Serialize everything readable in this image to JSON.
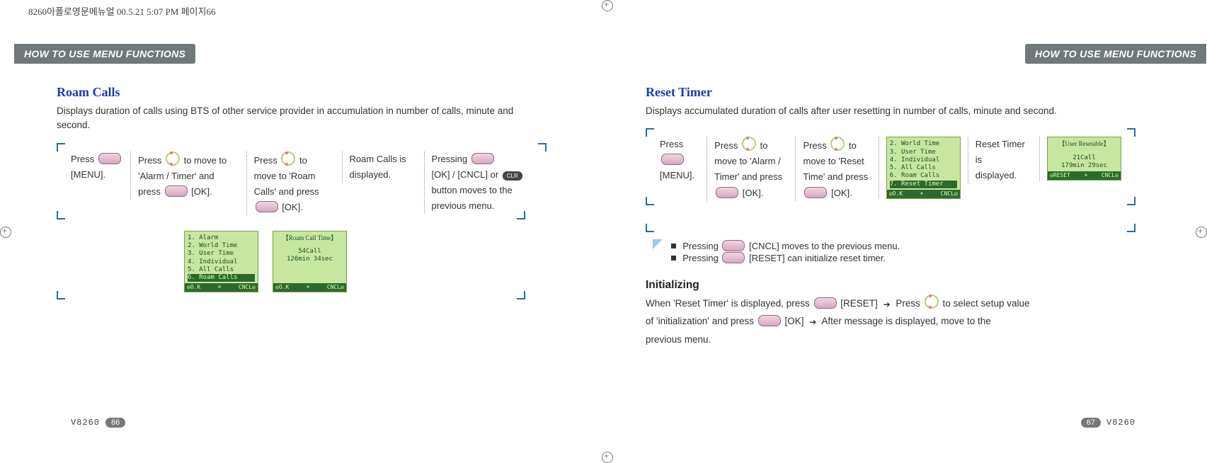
{
  "crop_note": "8260아폴로영문메뉴얼  00.5.21 5:07 PM  페이지66",
  "tab_label": "HOW TO USE MENU FUNCTIONS",
  "left_page": {
    "title": "Roam Calls",
    "desc": "Displays duration of calls using BTS of other service provider in accumulation in number of calls, minute and second.",
    "steps": {
      "s1_a": "Press",
      "s1_b": "[MENU].",
      "s2_a": "Press",
      "s2_b": "to move to",
      "s2_c": "'Alarm / Timer' and",
      "s2_d": "press",
      "s2_e": "[OK].",
      "s3_a": "Press",
      "s3_b": "to",
      "s3_c": "move to 'Roam",
      "s3_d": "Calls' and press",
      "s3_e": "[OK].",
      "s4_a": "Roam Calls is",
      "s4_b": "displayed.",
      "s5_a": "Pressing",
      "s5_b": "[OK] / [CNCL] or",
      "s5_c": "button moves to the",
      "s5_d": "previous menu."
    },
    "screen_menu": {
      "l1": "1. Alarm",
      "l2": "2. World Time",
      "l3": "3. User Time",
      "l4": "4. Individual",
      "l5": "5. All Calls",
      "hl": "6. Roam Calls",
      "bar_l": "◎O.K",
      "bar_r": "CNCL◎"
    },
    "screen_result": {
      "title": "【Roam Call Time】",
      "c1": "54Call",
      "c2": "126min 34sec",
      "bar_l": "◎O.K",
      "bar_r": "CNCL◎"
    },
    "model": "V8260",
    "page_no": "66"
  },
  "right_page": {
    "title": "Reset Timer",
    "desc": "Displays accumulated duration of calls after user resetting in number of calls, minute and second.",
    "steps": {
      "s1_a": "Press",
      "s1_b": "[MENU].",
      "s2_a": "Press",
      "s2_b": "to",
      "s2_c": "move to 'Alarm /",
      "s2_d": "Timer' and press",
      "s2_e": "[OK].",
      "s3_a": "Press",
      "s3_b": "to",
      "s3_c": "move to 'Reset",
      "s3_d": "Time' and press",
      "s3_e": "[OK].",
      "s5_a": "Reset Timer is",
      "s5_b": "displayed."
    },
    "screen_menu": {
      "l1": "2. World Time",
      "l2": "3. User Time",
      "l3": "4. Individual",
      "l4": "5. All Calls",
      "l5": "6. Roam Calls",
      "hl": "7. Reset Timer",
      "bar_l": "◎O.K",
      "bar_r": "CNCL◎"
    },
    "screen_result": {
      "title": "【User Resetable】",
      "c1": "21Call",
      "c2": "179min 29sec",
      "bar_l": "◎RESET",
      "bar_r": "CNCL◎"
    },
    "notes": {
      "n1a": "Pressing",
      "n1b": "[CNCL] moves to the previous menu.",
      "n2a": "Pressing",
      "n2b": "[RESET] can initialize reset timer."
    },
    "initializing": {
      "heading": "Initializing",
      "p1a": "When 'Reset Timer' is displayed, press",
      "p1b": "[RESET]",
      "p1c": "Press",
      "p1d": "to select setup value",
      "p2a": "of 'initialization' and press",
      "p2b": "[OK]",
      "p2c": "After message is displayed, move to the",
      "p3": "previous menu."
    },
    "model": "V8260",
    "page_no": "67"
  },
  "clr_label": "CLR"
}
